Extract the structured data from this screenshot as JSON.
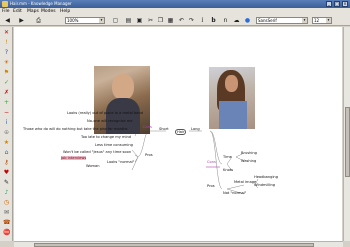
{
  "window": {
    "title": "Hair.mm - Knowledge Manager"
  },
  "menu": [
    "File",
    "Edit",
    "Maps",
    "Modes",
    "Help"
  ],
  "toolbar": {
    "zoom": "100%",
    "font": "SansSerif",
    "font_size": "12",
    "bold": "b",
    "italic": "i"
  },
  "map": {
    "root": "Hair",
    "left_branch": "Short",
    "right_branch": "Long",
    "short_cons": {
      "label": "Cons",
      "items": [
        "Looks (really) out of place in a metal band",
        "No-one will recognise me",
        "Those who do will do nothing but take the piss for months",
        "Too late to change my mind"
      ]
    },
    "short_pros": {
      "label": "Pros",
      "items": [
        "Less time consuming",
        "Won't be called \"Jesus\" any time soon",
        "Job interviews",
        "Looks \"normal\""
      ],
      "sub_label": "Woman"
    },
    "long_cons": {
      "label": "Cons",
      "time": "Time",
      "time_items": [
        "Brushing",
        "Washing"
      ],
      "knots": "Knots"
    },
    "long_pros": {
      "label": "Pros",
      "items": [
        "Metal image",
        "Headbanging",
        "Windmilling",
        "Not \"normal\""
      ]
    }
  },
  "colors": {
    "branch_pink": "#b040b0",
    "link": "#888888",
    "highlight": "#e8b8c8"
  }
}
